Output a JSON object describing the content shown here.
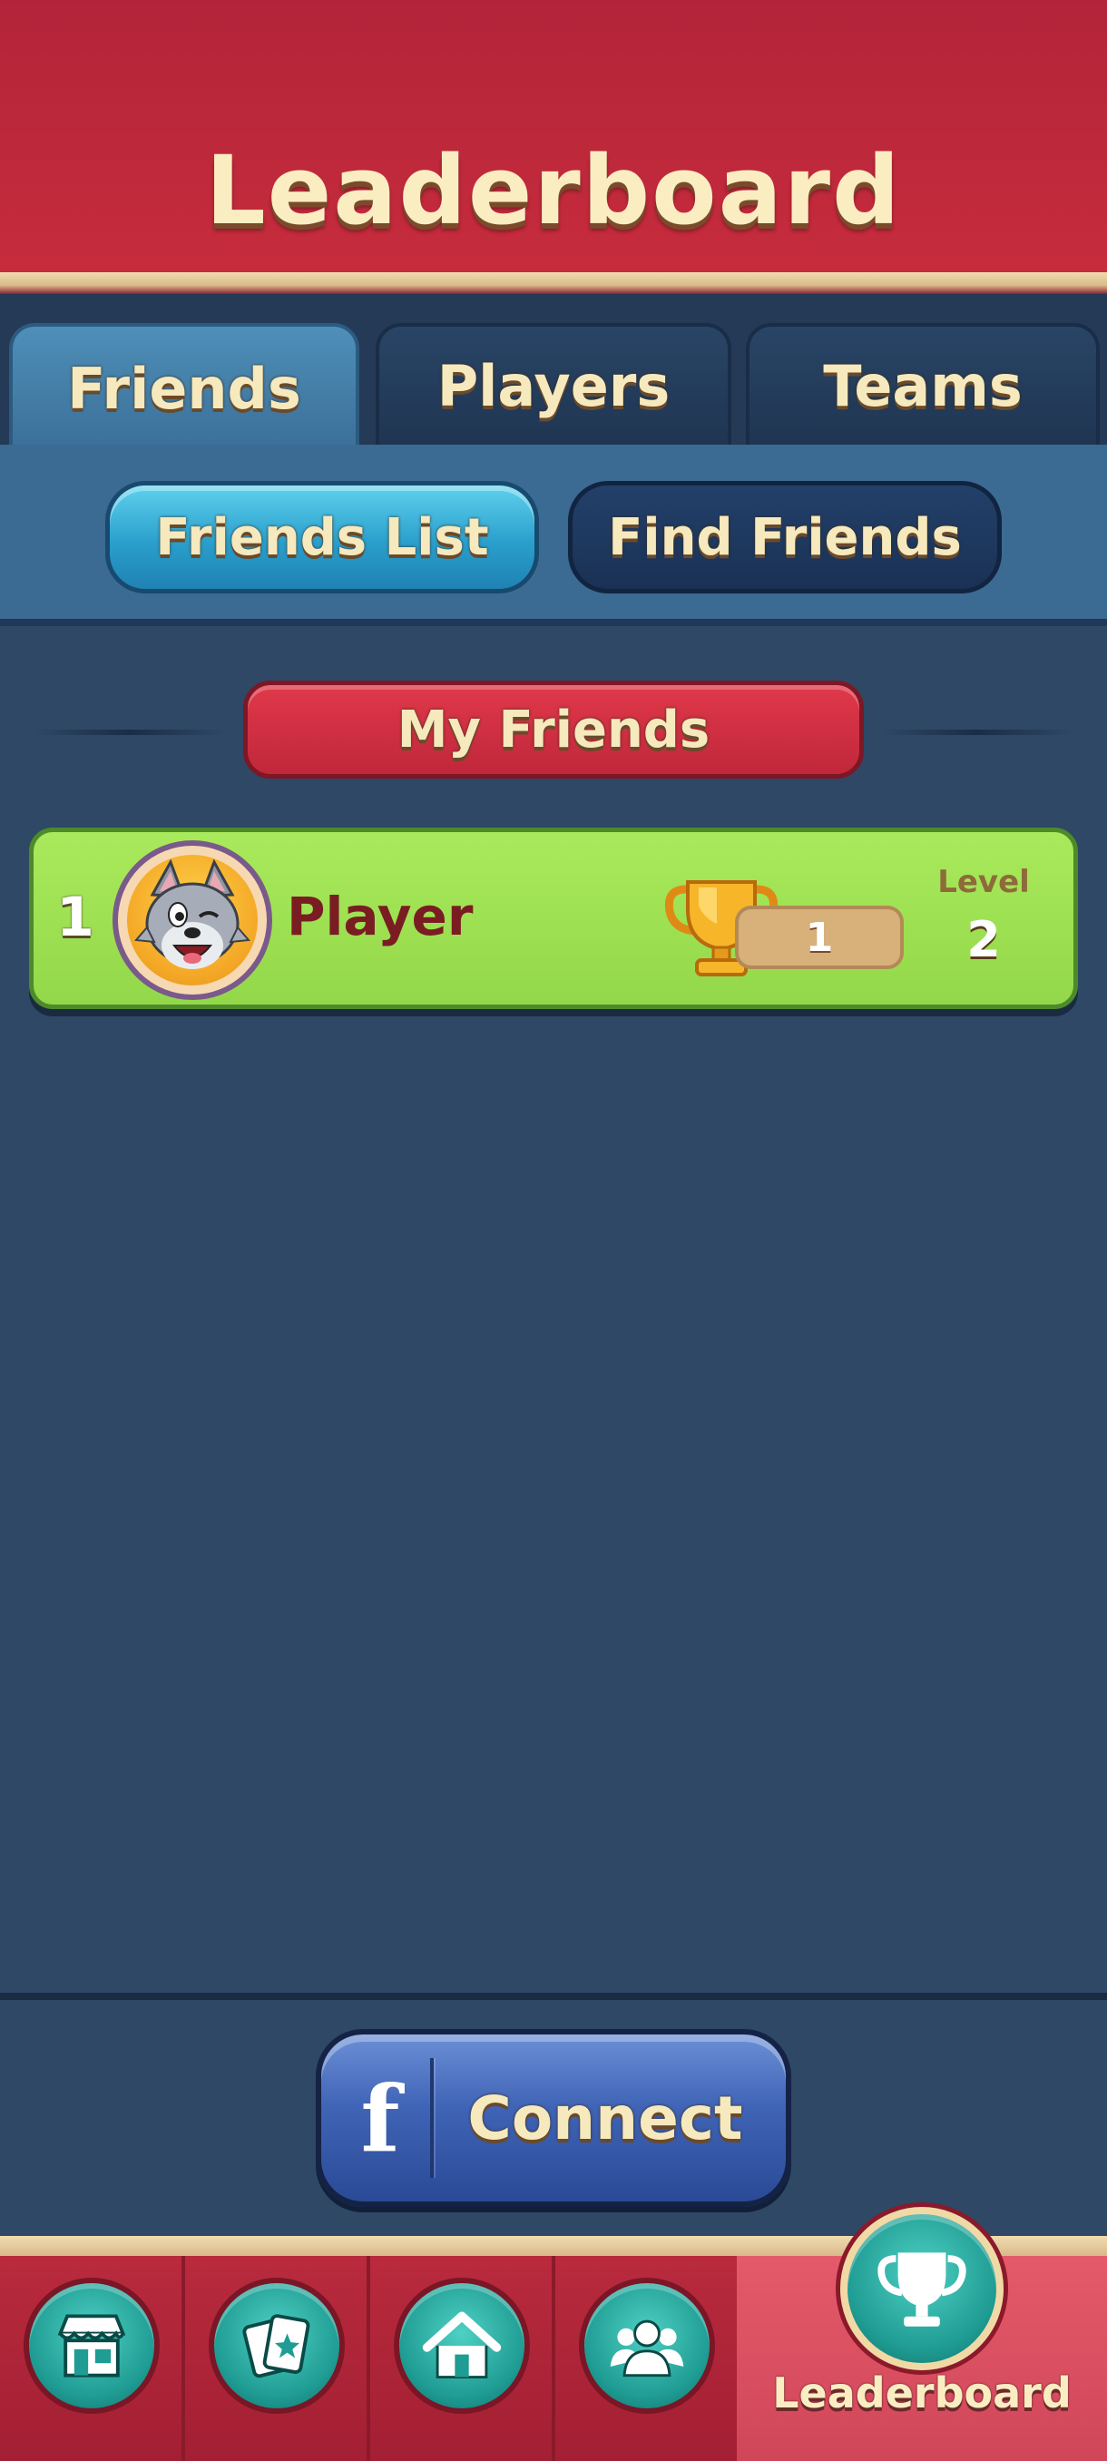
{
  "header": {
    "title": "Leaderboard"
  },
  "tabs": [
    {
      "label": "Friends",
      "active": true
    },
    {
      "label": "Players",
      "active": false
    },
    {
      "label": "Teams",
      "active": false
    }
  ],
  "subtabs": [
    {
      "label": "Friends List",
      "active": true
    },
    {
      "label": "Find Friends",
      "active": false
    }
  ],
  "section": {
    "title": "My Friends"
  },
  "friends": [
    {
      "rank": "1",
      "name": "Player",
      "avatar": "wolf-avatar-icon",
      "trophies": "1",
      "level_label": "Level",
      "level": "2"
    }
  ],
  "connect": {
    "icon": "facebook-icon",
    "label": "Connect"
  },
  "nav": {
    "items": [
      {
        "icon": "shop-icon",
        "active": false
      },
      {
        "icon": "cards-icon",
        "active": false
      },
      {
        "icon": "home-icon",
        "active": false
      },
      {
        "icon": "friends-group-icon",
        "active": false
      },
      {
        "icon": "trophy-icon",
        "label": "Leaderboard",
        "active": true
      }
    ]
  },
  "colors": {
    "header_red": "#c72c3c",
    "background_navy": "#2e4866",
    "row_green": "#a9ea5c",
    "accent_teal": "#1f9c93",
    "cream_text": "#f6e9bd"
  }
}
